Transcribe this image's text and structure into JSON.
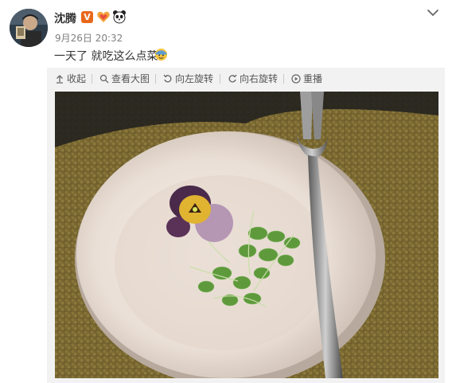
{
  "user": {
    "name": "沈腾",
    "verified_mark": "V"
  },
  "post": {
    "timestamp": "9月26日 20:32",
    "text": "一天了 就吃这么点菜"
  },
  "toolbar": {
    "collapse": "收起",
    "view_large": "查看大图",
    "rotate_left": "向左旋转",
    "rotate_right": "向右旋转",
    "slideshow": "重播"
  },
  "icons": {
    "verified": "verified-v-icon",
    "badge2": "heart-badge-icon",
    "badge3": "panda-badge-icon",
    "emoji": "emoji-icon",
    "menu": "chevron-down-icon"
  },
  "colors": {
    "verified": "#e8681b",
    "panel": "#f2f2f2",
    "text": "#333333",
    "muted": "#808080"
  }
}
